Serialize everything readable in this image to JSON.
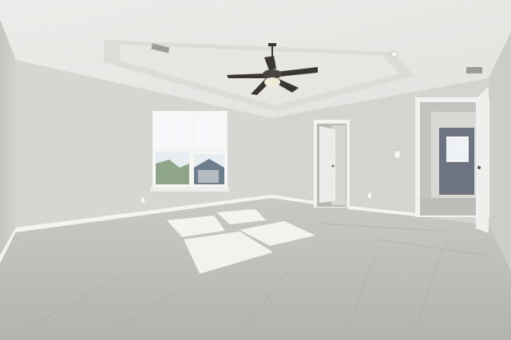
{
  "scene": {
    "kind": "empty-bedroom-interior",
    "colors": {
      "ceiling": "#e9e9e6",
      "tray": "#dededa",
      "wall_back": "#d8d8d4",
      "wall_left": "#cacac6",
      "wall_right": "#d2d2ce",
      "carpet": "#b9b9b6",
      "trim": "#f4f4f2",
      "sunlight": "#f7f7f4",
      "window_sky": "#f2f5f7",
      "fan": "#3a3633"
    },
    "objects": [
      "tray-ceiling",
      "ceiling-fan",
      "double-hung-window",
      "closet-door",
      "hallway-door",
      "carpet-floor",
      "sunlight-patch"
    ]
  }
}
